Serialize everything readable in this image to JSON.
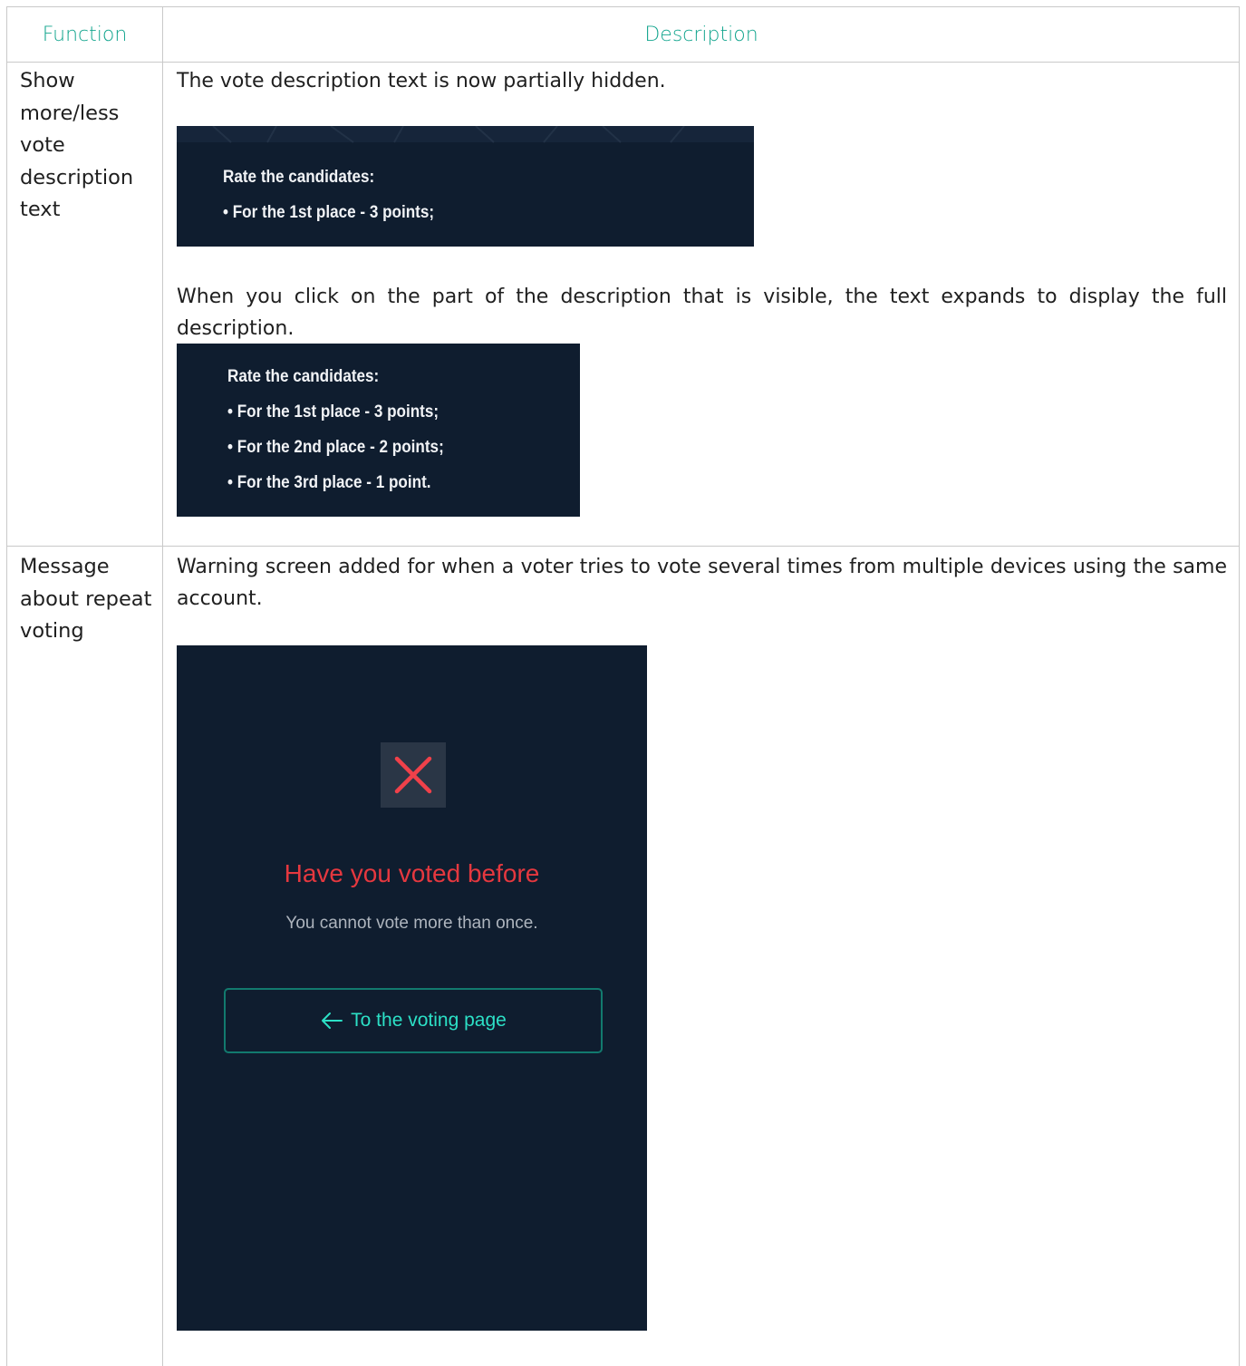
{
  "table": {
    "headers": {
      "function": "Function",
      "description": "Description"
    },
    "rows": [
      {
        "function": "Show more/less vote description text",
        "intro": "The vote description text is now partially hidden.",
        "collapsed_preview": {
          "title": "Rate the candidates:",
          "line1": "• For the 1st place - 3 points;"
        },
        "explain": "When you click on the part of the description that is visible, the text expands to display the full description.",
        "expanded_preview": {
          "title": "Rate the candidates:",
          "lines": [
            "• For the 1st place - 3 points;",
            "• For the 2nd place - 2 points;",
            "• For the 3rd place - 1 point."
          ]
        }
      },
      {
        "function": "Message about repeat voting",
        "intro": "Warning screen added for when a voter tries to vote several times from multiple devices using the same account.",
        "warning_screen": {
          "title": "Have you voted before",
          "subtitle": "You cannot vote more than once.",
          "button_label": "To the voting page"
        }
      }
    ]
  },
  "colors": {
    "header_text": "#13a58e",
    "screen_bg": "#0f1d2f",
    "error_red": "#e5383f",
    "accent_teal": "#2ce0c6"
  },
  "icons": [
    "close-x-icon",
    "arrow-left-icon"
  ]
}
